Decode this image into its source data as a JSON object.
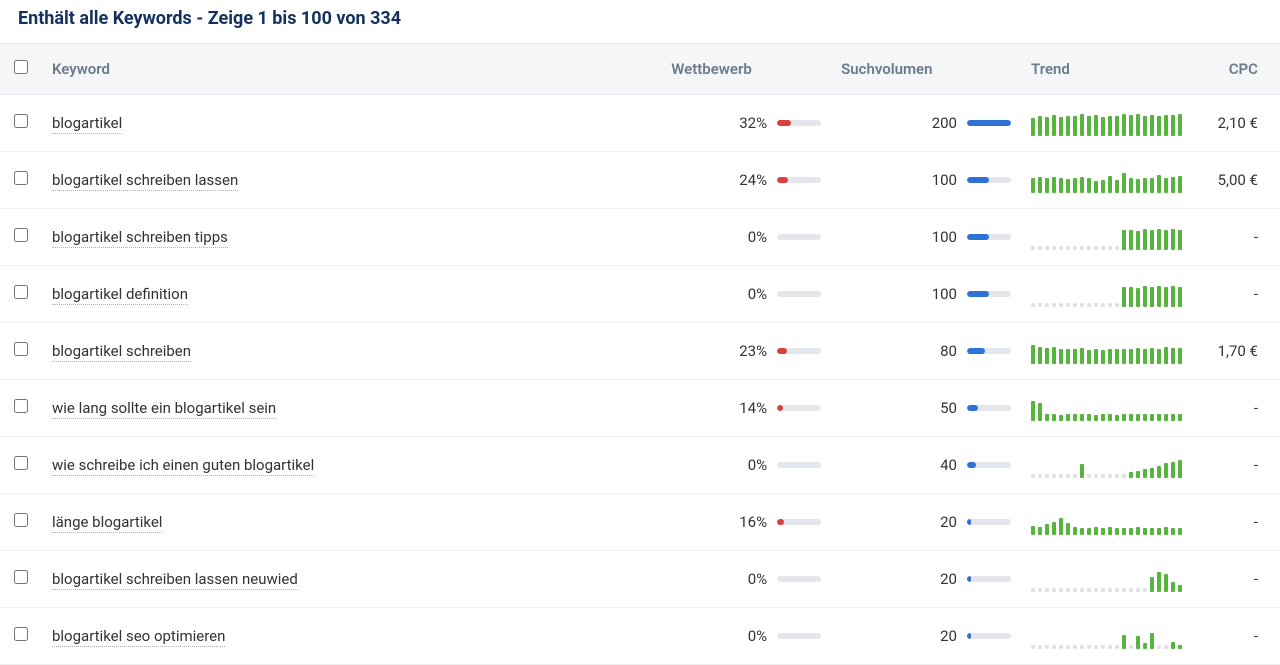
{
  "title": "Enthält alle Keywords - Zeige 1 bis 100 von 334",
  "columns": {
    "keyword": "Keyword",
    "competition": "Wettbewerb",
    "volume": "Suchvolumen",
    "trend": "Trend",
    "cpc": "CPC"
  },
  "max_volume": 200,
  "rows": [
    {
      "keyword": "blogartikel",
      "competition_pct": 32,
      "volume": 200,
      "cpc": "2,10 €",
      "trend": [
        80,
        90,
        85,
        95,
        88,
        92,
        90,
        100,
        92,
        95,
        88,
        92,
        90,
        100,
        95,
        98,
        92,
        95,
        90,
        96,
        94,
        98
      ]
    },
    {
      "keyword": "blogartikel schreiben lassen",
      "competition_pct": 24,
      "volume": 100,
      "cpc": "5,00 €",
      "trend": [
        70,
        72,
        68,
        74,
        70,
        64,
        66,
        72,
        68,
        56,
        60,
        76,
        58,
        90,
        66,
        62,
        70,
        66,
        82,
        70,
        72,
        76
      ]
    },
    {
      "keyword": "blogartikel schreiben tipps",
      "competition_pct": 0,
      "volume": 100,
      "cpc": "-",
      "trend": [
        0,
        0,
        0,
        0,
        0,
        0,
        0,
        0,
        0,
        0,
        0,
        0,
        0,
        90,
        92,
        88,
        94,
        90,
        96,
        92,
        94,
        90
      ]
    },
    {
      "keyword": "blogartikel definition",
      "competition_pct": 0,
      "volume": 100,
      "cpc": "-",
      "trend": [
        0,
        0,
        0,
        0,
        0,
        0,
        0,
        0,
        0,
        0,
        0,
        0,
        0,
        90,
        92,
        88,
        94,
        90,
        96,
        92,
        94,
        90
      ]
    },
    {
      "keyword": "blogartikel schreiben",
      "competition_pct": 23,
      "volume": 80,
      "cpc": "1,70 €",
      "trend": [
        86,
        78,
        72,
        76,
        68,
        70,
        66,
        72,
        64,
        68,
        62,
        70,
        66,
        68,
        70,
        74,
        68,
        72,
        70,
        76,
        72,
        74
      ]
    },
    {
      "keyword": "wie lang sollte ein blogartikel sein",
      "competition_pct": 14,
      "volume": 50,
      "cpc": "-",
      "trend": [
        90,
        80,
        34,
        30,
        28,
        32,
        30,
        34,
        30,
        28,
        32,
        30,
        28,
        32,
        30,
        34,
        30,
        32,
        30,
        34,
        32,
        30
      ]
    },
    {
      "keyword": "wie schreibe ich einen guten blogartikel",
      "competition_pct": 0,
      "volume": 40,
      "cpc": "-",
      "trend": [
        0,
        0,
        0,
        0,
        0,
        0,
        0,
        62,
        0,
        0,
        0,
        0,
        0,
        0,
        26,
        34,
        40,
        46,
        54,
        68,
        74,
        80
      ]
    },
    {
      "keyword": "länge blogartikel",
      "competition_pct": 16,
      "volume": 20,
      "cpc": "-",
      "trend": [
        42,
        36,
        52,
        58,
        78,
        54,
        38,
        34,
        30,
        38,
        32,
        36,
        30,
        34,
        32,
        36,
        30,
        34,
        32,
        36,
        30,
        34
      ]
    },
    {
      "keyword": "blogartikel schreiben lassen neuwied",
      "competition_pct": 0,
      "volume": 20,
      "cpc": "-",
      "trend": [
        0,
        0,
        0,
        0,
        0,
        0,
        0,
        0,
        0,
        0,
        0,
        0,
        0,
        0,
        0,
        0,
        0,
        70,
        90,
        84,
        44,
        30
      ]
    },
    {
      "keyword": "blogartikel seo optimieren",
      "competition_pct": 0,
      "volume": 20,
      "cpc": "-",
      "trend": [
        0,
        0,
        0,
        0,
        0,
        0,
        0,
        0,
        0,
        0,
        0,
        0,
        0,
        62,
        0,
        60,
        28,
        74,
        0,
        0,
        30,
        18
      ]
    }
  ]
}
